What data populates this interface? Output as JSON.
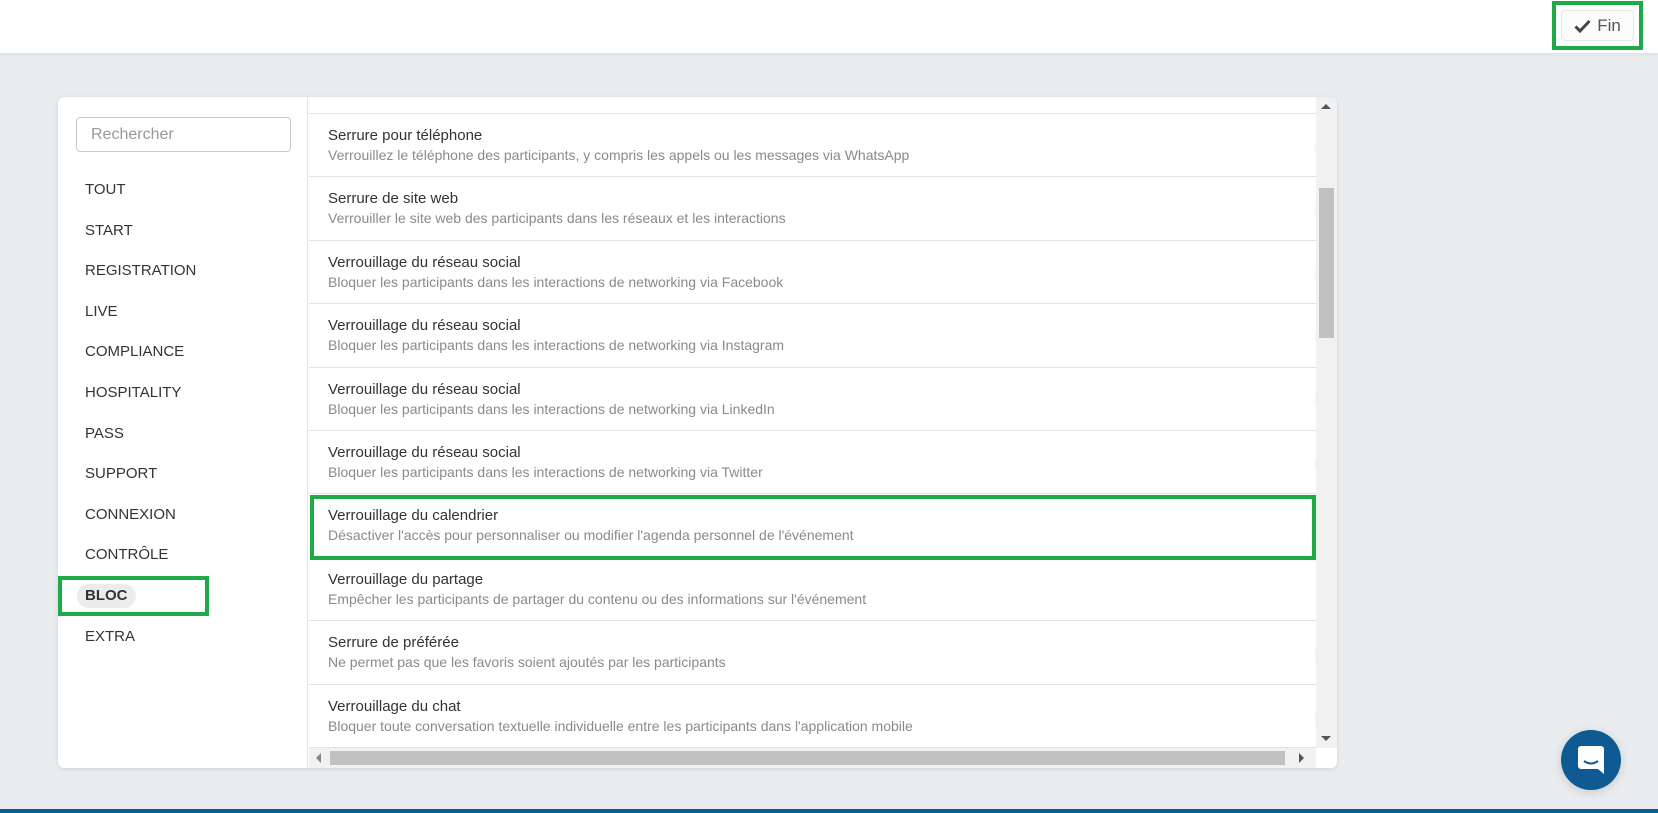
{
  "header": {
    "done_label": "Fin",
    "done_icon": "check-icon"
  },
  "sidebar": {
    "search_placeholder": "Rechercher",
    "items": [
      {
        "label": "TOUT"
      },
      {
        "label": "START"
      },
      {
        "label": "REGISTRATION"
      },
      {
        "label": "LIVE"
      },
      {
        "label": "COMPLIANCE"
      },
      {
        "label": "HOSPITALITY"
      },
      {
        "label": "PASS"
      },
      {
        "label": "SUPPORT"
      },
      {
        "label": "CONNEXION"
      },
      {
        "label": "CONTRÔLE"
      },
      {
        "label": "BLOC",
        "active": true
      },
      {
        "label": "EXTRA"
      }
    ]
  },
  "settings": [
    {
      "title": "Serrure pour téléphone",
      "desc": "Verrouillez le téléphone des participants, y compris les appels ou les messages via WhatsApp",
      "enabled": false
    },
    {
      "title": "Serrure de site web",
      "desc": "Verrouiller le site web des participants dans les réseaux et les interactions",
      "enabled": false
    },
    {
      "title": "Verrouillage du réseau social",
      "desc": "Bloquer les participants dans les interactions de networking via Facebook",
      "enabled": false
    },
    {
      "title": "Verrouillage du réseau social",
      "desc": "Bloquer les participants dans les interactions de networking via Instagram",
      "enabled": false
    },
    {
      "title": "Verrouillage du réseau social",
      "desc": "Bloquer les participants dans les interactions de networking via LinkedIn",
      "enabled": false
    },
    {
      "title": "Verrouillage du réseau social",
      "desc": "Bloquer les participants dans les interactions de networking via Twitter",
      "enabled": false
    },
    {
      "title": "Verrouillage du calendrier",
      "desc": "Désactiver l'accès pour personnaliser ou modifier l'agenda personnel de l'événement",
      "enabled": true
    },
    {
      "title": "Verrouillage du partage",
      "desc": "Empêcher les participants de partager du contenu ou des informations sur l'événement",
      "enabled": true
    },
    {
      "title": "Serrure de préférée",
      "desc": "Ne permet pas que les favoris soient ajoutés par les participants",
      "enabled": false
    },
    {
      "title": "Verrouillage du chat",
      "desc": "Bloquer toute conversation textuelle individuelle entre les participants dans l'application mobile",
      "enabled": false
    }
  ],
  "colors": {
    "highlight": "#1faa4a",
    "toggle_on": "#4cd068",
    "chat_button": "#0f5a93"
  },
  "chat_icon": "chat-bubble-icon"
}
